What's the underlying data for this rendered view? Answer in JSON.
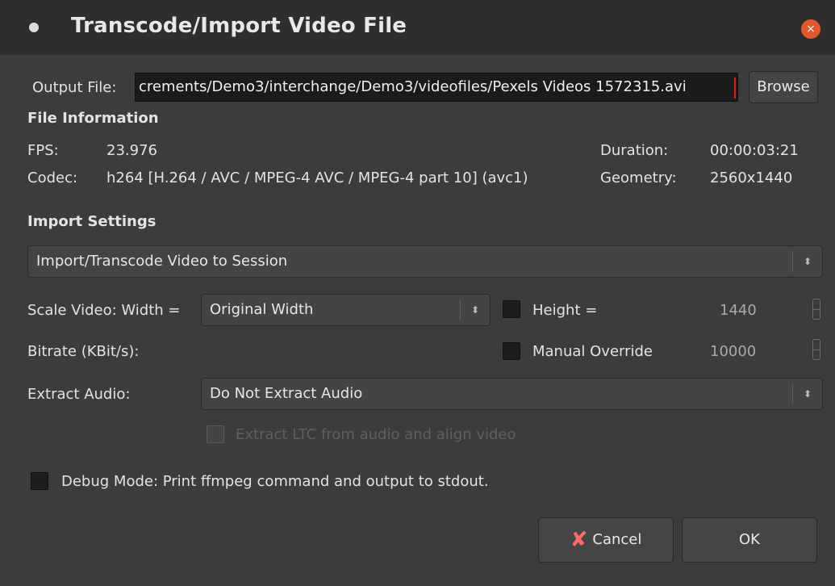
{
  "window": {
    "title": "Transcode/Import Video File",
    "close_glyph": "×",
    "icons": {
      "window_menu": "window-dot-icon",
      "close": "close-icon"
    }
  },
  "output": {
    "label": "Output File:",
    "path": "crements/Demo3/interchange/Demo3/videofiles/Pexels Videos 1572315.avi",
    "browse_label": "Browse"
  },
  "file_info": {
    "heading": "File Information",
    "fps_label": "FPS:",
    "fps_value": "23.976",
    "codec_label": "Codec:",
    "codec_value": "h264 [H.264 / AVC / MPEG-4 AVC / MPEG-4 part 10] (avc1)",
    "duration_label": "Duration:",
    "duration_value": "00:00:03:21",
    "geometry_label": "Geometry:",
    "geometry_value": "2560x1440"
  },
  "import_settings": {
    "heading": "Import Settings",
    "mode_selected": "Import/Transcode Video to Session",
    "scale_label": "Scale Video: Width =",
    "width_selected": "Original Width",
    "height_label": "Height =",
    "height_checked": false,
    "height_value": "1440",
    "bitrate_label": "Bitrate (KBit/s):",
    "manual_override_label": "Manual Override",
    "manual_override_checked": false,
    "bitrate_value": "10000",
    "extract_audio_label": "Extract Audio:",
    "extract_audio_selected": "Do Not Extract Audio",
    "ltc_label": "Extract LTC from audio and align video",
    "ltc_enabled": false,
    "debug_label": "Debug Mode: Print ffmpeg command and output to stdout.",
    "debug_checked": false
  },
  "buttons": {
    "cancel_label": "Cancel",
    "ok_label": "OK"
  },
  "colors": {
    "titlebar": "#2e2e2e",
    "dialog_bg": "#3c3c3c",
    "close_button": "#e2572f",
    "cancel_icon": "#ff6b6b",
    "caret": "#e02020"
  },
  "combo_arrow_glyph": "⬍",
  "cancel_icon_glyph": "✘"
}
